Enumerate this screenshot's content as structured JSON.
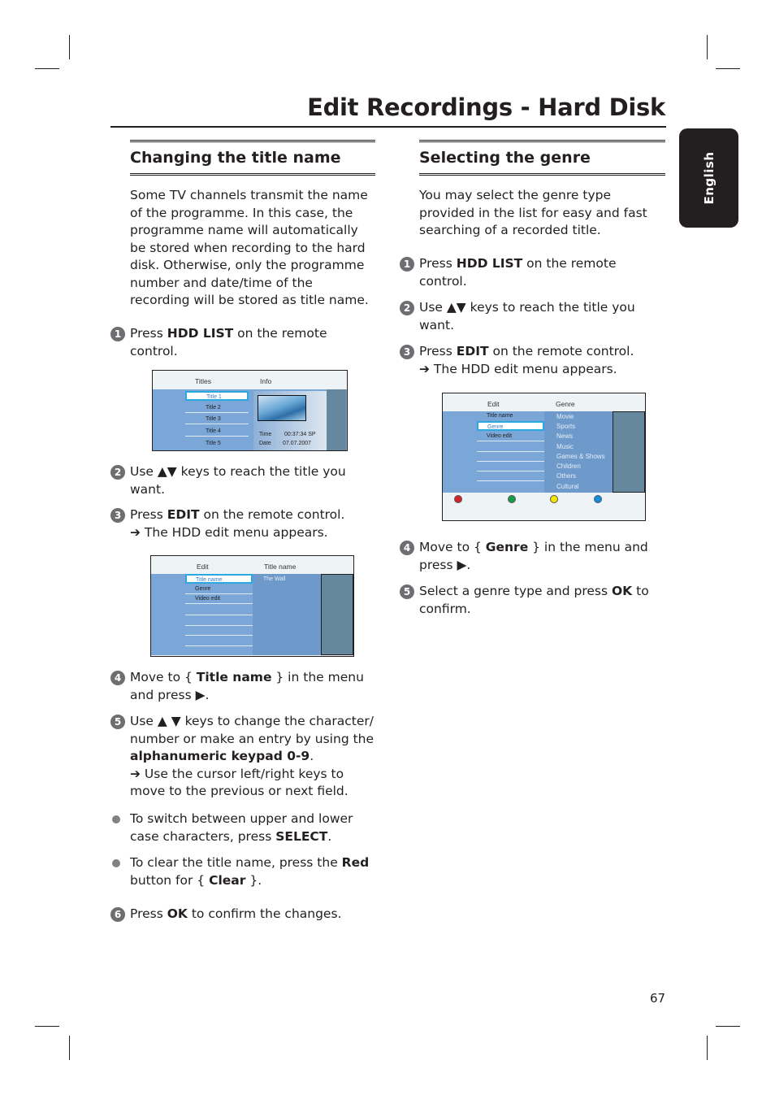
{
  "page": {
    "title": "Edit Recordings - Hard Disk",
    "language_tab": "English",
    "page_number": "67"
  },
  "left": {
    "heading": "Changing the title name",
    "intro": "Some TV channels transmit the name of the programme. In this case, the programme name will automatically be stored when recording to the hard disk. Otherwise, only the programme number and date/time of the recording will be stored as title name.",
    "steps": [
      {
        "num": "1",
        "pre": "Press ",
        "bold": "HDD LIST",
        "post": " on the remote control."
      },
      {
        "num": "2",
        "text": "Use ▲▼ keys to reach the title you want."
      },
      {
        "num": "3",
        "pre": "Press ",
        "bold": "EDIT",
        "post": " on the remote control.",
        "result": "➔ The HDD edit menu appears."
      },
      {
        "num": "4",
        "pre": "Move to { ",
        "bold": "Title name",
        "post": " } in the menu and press ▶."
      },
      {
        "num": "5",
        "pre": "Use ▲ ▼ keys to change the character/ number or make an entry by using the ",
        "bold": "alphanumeric keypad 0-9",
        "post": ".",
        "result": "➔ Use the cursor left/right keys to move to the previous or next field."
      },
      {
        "num": "6",
        "pre": "Press ",
        "bold": "OK",
        "post": " to confirm the changes."
      }
    ],
    "bullets": [
      {
        "pre": "To switch between upper and lower case characters, press ",
        "bold": "SELECT",
        "post": "."
      },
      {
        "pre": "To clear the title name, press the ",
        "bold": "Red",
        "post": " button for { ",
        "bold2": "Clear",
        "post2": " }."
      }
    ],
    "screen1": {
      "col1": "Titles",
      "col2": "Info",
      "items": [
        "Title 1",
        "Title 2",
        "Title 3",
        "Title 4",
        "Title 5"
      ],
      "selected": "Title 1",
      "time_label": "Time",
      "time_value": "00:37:34  SP",
      "date_label": "Date",
      "date_value": "07.07.2007"
    },
    "screen2": {
      "col1": "Edit",
      "col2": "Title name",
      "items": [
        "Title name",
        "Genre",
        "Video edit"
      ],
      "selected": "Title name",
      "value": "The Wall"
    }
  },
  "right": {
    "heading": "Selecting the genre",
    "intro": "You may select the genre type provided in the list for easy and fast searching of a recorded title.",
    "steps": [
      {
        "num": "1",
        "pre": "Press ",
        "bold": "HDD LIST",
        "post": " on the remote control."
      },
      {
        "num": "2",
        "text": "Use ▲▼ keys to reach the title you want."
      },
      {
        "num": "3",
        "pre": "Press ",
        "bold": "EDIT",
        "post": " on the remote control.",
        "result": "➔ The HDD edit menu appears."
      },
      {
        "num": "4",
        "pre": "Move to { ",
        "bold": "Genre",
        "post": " } in the menu and press ▶."
      },
      {
        "num": "5",
        "pre": "Select a genre type and press ",
        "bold": "OK",
        "post": " to confirm."
      }
    ],
    "screen3": {
      "col1": "Edit",
      "col2": "Genre",
      "items": [
        "Title name",
        "Genre",
        "Video edit"
      ],
      "selected": "Genre",
      "genres": [
        "Movie",
        "Sports",
        "News",
        "Music",
        "Games & Shows",
        "Children",
        "Others",
        "Cultural"
      ],
      "color_keys": {
        "red": "#d2232a",
        "green": "#1a9a48",
        "yellow": "#f2e600",
        "blue": "#0f8fd9"
      }
    }
  }
}
